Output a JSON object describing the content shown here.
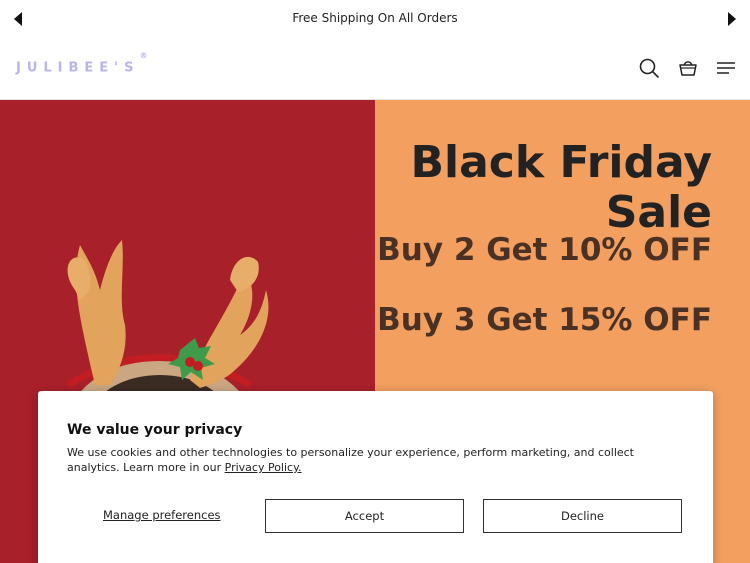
{
  "announcement": {
    "text": "Free Shipping On All Orders",
    "prev_icon": "triangle-left-icon",
    "next_icon": "triangle-right-icon"
  },
  "header": {
    "logo_text": "JULIBEE'S",
    "logo_mark": "®",
    "icons": [
      "search-icon",
      "cart-icon",
      "menu-icon"
    ]
  },
  "hero": {
    "title_line1": "Black Friday",
    "title_line2": "Sale",
    "offer1": "Buy 2 Get 10% OFF",
    "offer2": "Buy 3 Get 15% OFF",
    "colors": {
      "left_panel": "#a8202a",
      "right_panel": "#f29f60"
    }
  },
  "cookie_banner": {
    "title": "We value your privacy",
    "body": "We use cookies and other technologies to personalize your experience, perform marketing, and collect analytics. Learn more in our",
    "link_text": "Privacy Policy.",
    "manage_label": "Manage preferences",
    "accept_label": "Accept",
    "decline_label": "Decline"
  }
}
